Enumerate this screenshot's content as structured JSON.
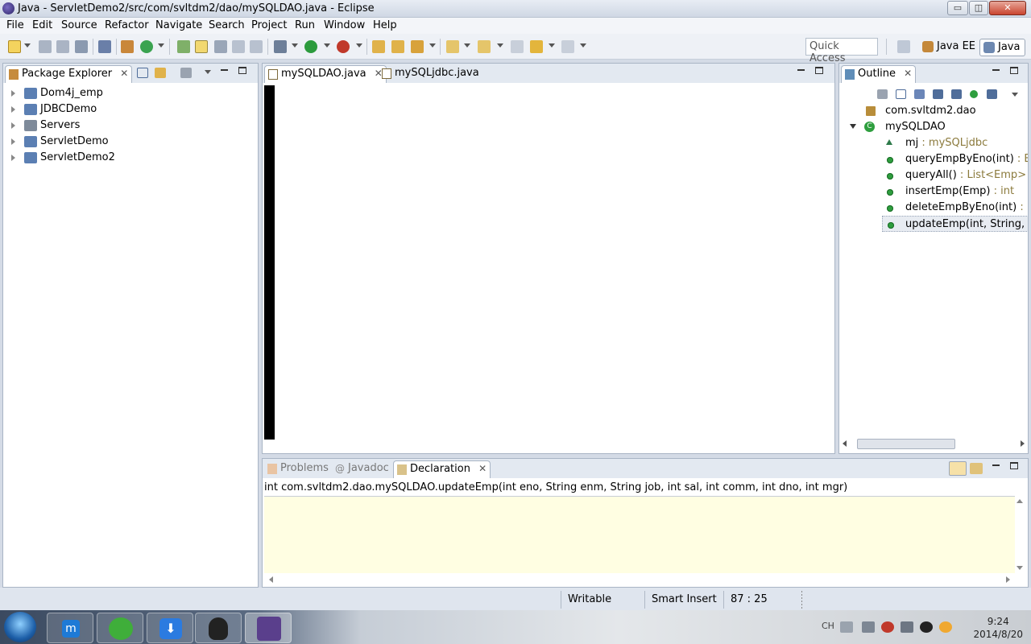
{
  "window": {
    "title": "Java - ServletDemo2/src/com/svltdm2/dao/mySQLDAO.java - Eclipse",
    "min_label": "▭",
    "max_label": "◫",
    "close_label": "✕"
  },
  "menu": [
    "File",
    "Edit",
    "Source",
    "Refactor",
    "Navigate",
    "Search",
    "Project",
    "Run",
    "Window",
    "Help"
  ],
  "toolbar": {
    "quick_access_placeholder": "Quick Access",
    "perspectives": [
      "Java EE",
      "Java"
    ]
  },
  "package_explorer": {
    "title": "Package Explorer",
    "projects": [
      "Dom4j_emp",
      "JDBCDemo",
      "Servers",
      "ServletDemo",
      "ServletDemo2"
    ]
  },
  "editor": {
    "tabs": [
      "mySQLDAO.java",
      "mySQLjdbc.java"
    ]
  },
  "outline": {
    "title": "Outline",
    "package": "com.svltdm2.dao",
    "class": "mySQLDAO",
    "members": [
      {
        "name": "mj",
        "type": " : mySQLjdbc"
      },
      {
        "name": "queryEmpByEno(int)",
        "type": " : Emp"
      },
      {
        "name": "queryAll()",
        "type": " : List<Emp>"
      },
      {
        "name": "insertEmp(Emp)",
        "type": " : int"
      },
      {
        "name": "deleteEmpByEno(int)",
        "type": " : int"
      },
      {
        "name": "updateEmp(int, String, Stri",
        "type": ""
      }
    ]
  },
  "bottom_panel": {
    "tabs": [
      "Problems",
      "Javadoc",
      "Declaration"
    ],
    "declaration_signature": "int com.svltdm2.dao.mySQLDAO.updateEmp(int eno, String enm, String job, int sal, int comm, int dno, int mgr)"
  },
  "status": {
    "writable": "Writable",
    "insert_mode": "Smart Insert",
    "position": "87 : 25"
  },
  "taskbar": {
    "ime": "CH",
    "time": "9:24",
    "date": "2014/8/20"
  }
}
